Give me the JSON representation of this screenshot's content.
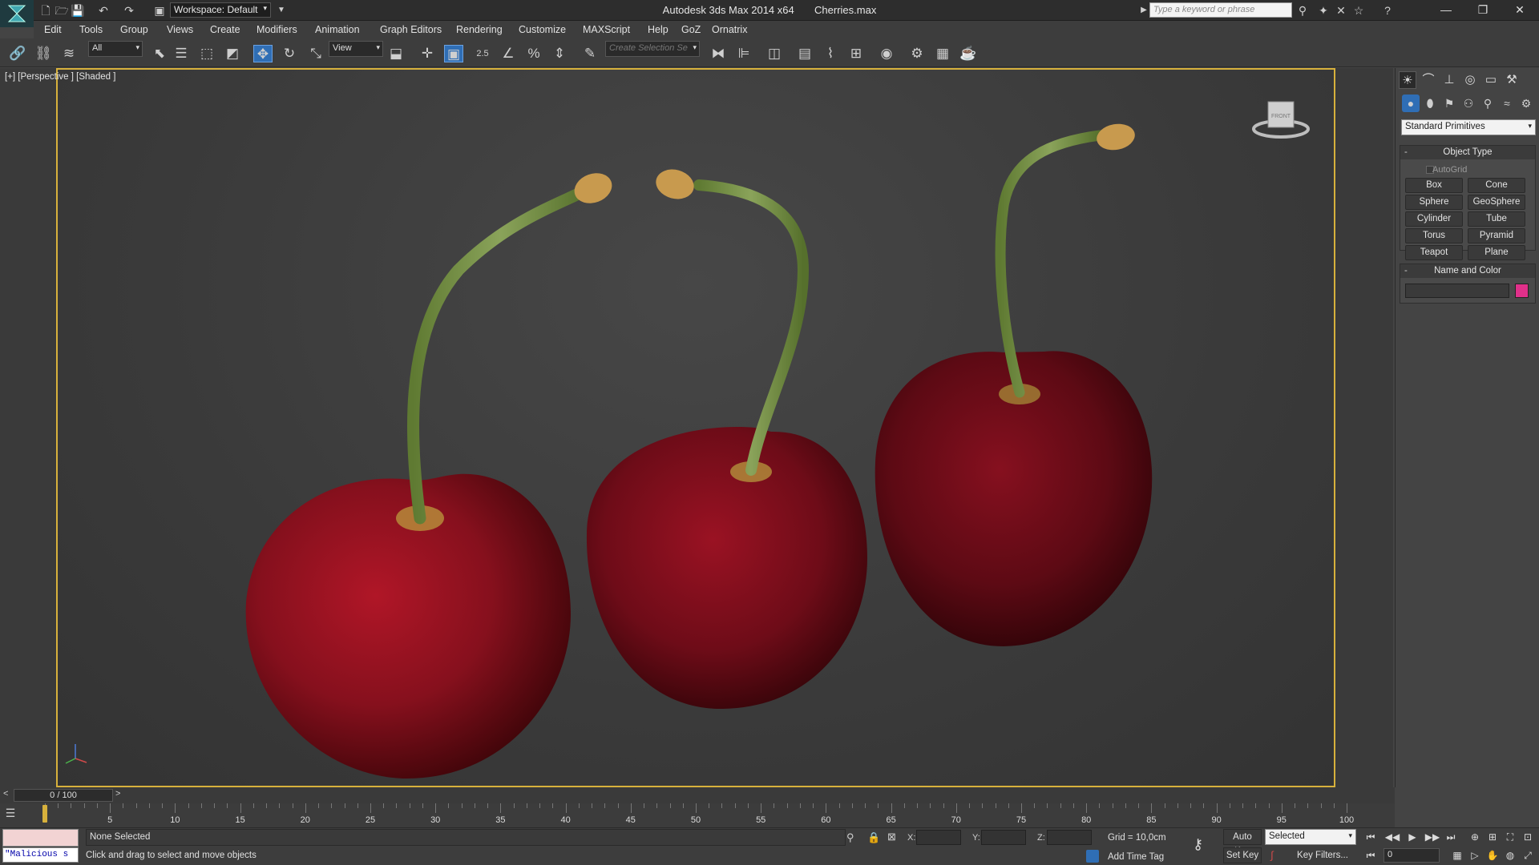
{
  "window": {
    "app_title": "Autodesk 3ds Max  2014 x64",
    "file_name": "Cherries.max",
    "workspace_label": "Workspace: Default",
    "search_placeholder": "Type a keyword or phrase",
    "minimize": "—",
    "restore": "❐",
    "close": "✕"
  },
  "menu": [
    "Edit",
    "Tools",
    "Group",
    "Views",
    "Create",
    "Modifiers",
    "Animation",
    "Graph Editors",
    "Rendering",
    "Customize",
    "MAXScript",
    "Help",
    "GoZ",
    "Ornatrix"
  ],
  "toolbar": {
    "selection_filter": "All",
    "reference_coord": "View",
    "snap_value": "2.5",
    "selection_set_placeholder": "Create Selection Se"
  },
  "viewport": {
    "label": "[+] [Perspective ] [Shaded ]",
    "viewcube_label": "FRONT",
    "border_color": "#d7b13c"
  },
  "command_panel": {
    "category": "Standard Primitives",
    "object_type_title": "Object Type",
    "autogrid_label": "AutoGrid",
    "primitives": [
      "Box",
      "Cone",
      "Sphere",
      "GeoSphere",
      "Cylinder",
      "Tube",
      "Torus",
      "Pyramid",
      "Teapot",
      "Plane"
    ],
    "name_color_title": "Name and Color",
    "object_color": "#e0308a",
    "collapse_symbol": "-"
  },
  "timeline": {
    "frame_display": "0 / 100",
    "prev_label": "<",
    "next_label": ">",
    "tick_labels": [
      "5",
      "10",
      "15",
      "20",
      "25",
      "30",
      "35",
      "40",
      "45",
      "50",
      "55",
      "60",
      "65",
      "70",
      "75",
      "80",
      "85",
      "90",
      "95",
      "100"
    ]
  },
  "status": {
    "maxscript_text": "\"Malicious s",
    "selection": "None Selected",
    "prompt": "Click and drag to select and move objects",
    "x_label": "X:",
    "y_label": "Y:",
    "z_label": "Z:",
    "grid": "Grid = 10,0cm",
    "add_time_tag": "Add Time Tag",
    "auto_key": "Auto Key",
    "set_key": "Set Key",
    "key_mode": "Selected",
    "key_filters": "Key Filters...",
    "current_frame": "0"
  },
  "colors": {
    "accent_blue": "#2f6eb5",
    "cherry_red": "#8e0f1c",
    "stem_green": "#7d9a4a"
  }
}
